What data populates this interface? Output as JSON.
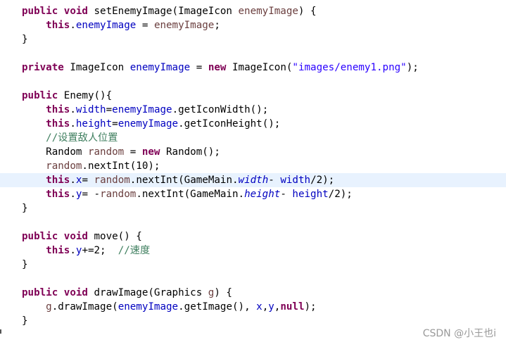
{
  "code_lines": [
    [
      [
        "kw",
        "public void "
      ],
      [
        "plain",
        "setEnemyImage(ImageIcon "
      ],
      [
        "local",
        "enemyImage"
      ],
      [
        "plain",
        ") {"
      ]
    ],
    [
      [
        "plain",
        "    "
      ],
      [
        "kw",
        "this"
      ],
      [
        "plain",
        "."
      ],
      [
        "field",
        "enemyImage"
      ],
      [
        "plain",
        " = "
      ],
      [
        "local",
        "enemyImage"
      ],
      [
        "plain",
        ";"
      ]
    ],
    [
      [
        "plain",
        "}"
      ]
    ],
    [],
    [
      [
        "kw",
        "private "
      ],
      [
        "plain",
        "ImageIcon "
      ],
      [
        "field",
        "enemyImage"
      ],
      [
        "plain",
        " = "
      ],
      [
        "kw",
        "new "
      ],
      [
        "plain",
        "ImageIcon("
      ],
      [
        "str",
        "\"images/enemy1.png\""
      ],
      [
        "plain",
        ");"
      ]
    ],
    [],
    [
      [
        "kw",
        "public "
      ],
      [
        "plain",
        "Enemy(){"
      ]
    ],
    [
      [
        "plain",
        "    "
      ],
      [
        "kw",
        "this"
      ],
      [
        "plain",
        "."
      ],
      [
        "field",
        "width"
      ],
      [
        "plain",
        "="
      ],
      [
        "field",
        "enemyImage"
      ],
      [
        "plain",
        ".getIconWidth();"
      ]
    ],
    [
      [
        "plain",
        "    "
      ],
      [
        "kw",
        "this"
      ],
      [
        "plain",
        "."
      ],
      [
        "field",
        "height"
      ],
      [
        "plain",
        "="
      ],
      [
        "field",
        "enemyImage"
      ],
      [
        "plain",
        ".getIconHeight();"
      ]
    ],
    [
      [
        "plain",
        "    "
      ],
      [
        "cmt",
        "//设置敌人位置"
      ]
    ],
    [
      [
        "plain",
        "    Random "
      ],
      [
        "local",
        "random"
      ],
      [
        "plain",
        " = "
      ],
      [
        "kw",
        "new "
      ],
      [
        "plain",
        "Random();"
      ]
    ],
    [
      [
        "plain",
        "    "
      ],
      [
        "local",
        "random"
      ],
      [
        "plain",
        ".nextInt(10);"
      ]
    ],
    [
      [
        "plain",
        "    "
      ],
      [
        "kw",
        "this"
      ],
      [
        "plain",
        "."
      ],
      [
        "field",
        "x"
      ],
      [
        "plain",
        "= "
      ],
      [
        "local",
        "random"
      ],
      [
        "plain",
        ".nextInt(GameMain."
      ],
      [
        "sfield",
        "width"
      ],
      [
        "plain",
        "- "
      ],
      [
        "field",
        "width"
      ],
      [
        "plain",
        "/2);"
      ]
    ],
    [
      [
        "plain",
        "    "
      ],
      [
        "kw",
        "this"
      ],
      [
        "plain",
        "."
      ],
      [
        "field",
        "y"
      ],
      [
        "plain",
        "= -"
      ],
      [
        "local",
        "random"
      ],
      [
        "plain",
        ".nextInt(GameMain."
      ],
      [
        "sfield",
        "height"
      ],
      [
        "plain",
        "- "
      ],
      [
        "field",
        "height"
      ],
      [
        "plain",
        "/2);"
      ]
    ],
    [
      [
        "plain",
        "}"
      ]
    ],
    [],
    [
      [
        "kw",
        "public void "
      ],
      [
        "plain",
        "move() {"
      ]
    ],
    [
      [
        "plain",
        "    "
      ],
      [
        "kw",
        "this"
      ],
      [
        "plain",
        "."
      ],
      [
        "field",
        "y"
      ],
      [
        "plain",
        "+=2;  "
      ],
      [
        "cmt",
        "//速度"
      ]
    ],
    [
      [
        "plain",
        "}"
      ]
    ],
    [],
    [
      [
        "kw",
        "public void "
      ],
      [
        "plain",
        "drawImage(Graphics "
      ],
      [
        "local",
        "g"
      ],
      [
        "plain",
        ") {"
      ]
    ],
    [
      [
        "plain",
        "    "
      ],
      [
        "local",
        "g"
      ],
      [
        "plain",
        ".drawImage("
      ],
      [
        "field",
        "enemyImage"
      ],
      [
        "plain",
        ".getImage(), "
      ],
      [
        "field",
        "x"
      ],
      [
        "plain",
        ","
      ],
      [
        "field",
        "y"
      ],
      [
        "plain",
        ","
      ],
      [
        "kw",
        "null"
      ],
      [
        "plain",
        ");"
      ]
    ],
    [
      [
        "plain",
        "}"
      ]
    ]
  ],
  "current_line": 12,
  "watermark": "CSDN @小王也i",
  "colors": {
    "keyword": "#7f0055",
    "field": "#0000c0",
    "string": "#2a00ff",
    "comment": "#3f7f5f",
    "local": "#6a3e3e",
    "current_line_bg": "#e8f2fe"
  }
}
